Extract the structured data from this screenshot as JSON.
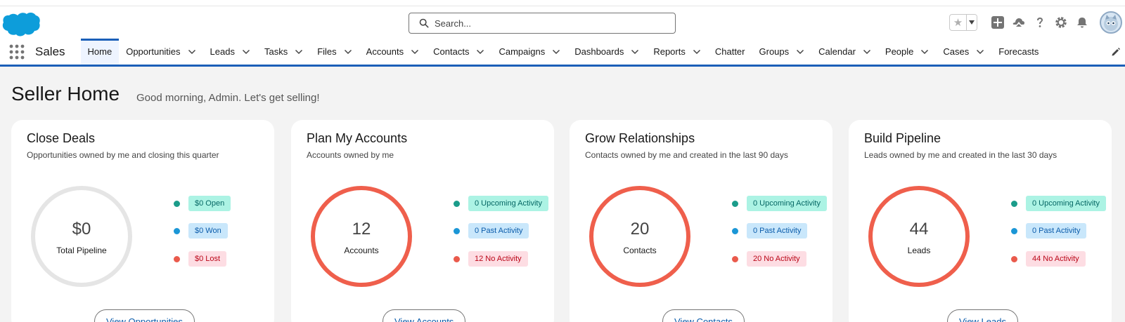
{
  "header": {
    "search_placeholder": "Search...",
    "icons": [
      "salesforce-cloud-logo",
      "star-icon",
      "chevron-down-icon",
      "plus-icon",
      "trailhead-icon",
      "help-icon",
      "gear-icon",
      "bell-icon",
      "avatar"
    ]
  },
  "nav": {
    "app_name": "Sales",
    "items": [
      {
        "label": "Home",
        "active": true,
        "dropdown": false
      },
      {
        "label": "Opportunities",
        "dropdown": true
      },
      {
        "label": "Leads",
        "dropdown": true
      },
      {
        "label": "Tasks",
        "dropdown": true
      },
      {
        "label": "Files",
        "dropdown": true
      },
      {
        "label": "Accounts",
        "dropdown": true
      },
      {
        "label": "Contacts",
        "dropdown": true
      },
      {
        "label": "Campaigns",
        "dropdown": true
      },
      {
        "label": "Dashboards",
        "dropdown": true
      },
      {
        "label": "Reports",
        "dropdown": true
      },
      {
        "label": "Chatter",
        "dropdown": false
      },
      {
        "label": "Groups",
        "dropdown": true
      },
      {
        "label": "Calendar",
        "dropdown": true
      },
      {
        "label": "People",
        "dropdown": true
      },
      {
        "label": "Cases",
        "dropdown": true
      },
      {
        "label": "Forecasts",
        "dropdown": false
      }
    ]
  },
  "page": {
    "title": "Seller Home",
    "greeting": "Good morning, Admin. Let's get selling!"
  },
  "cards": [
    {
      "title": "Close Deals",
      "subtitle": "Opportunities owned by me and closing this quarter",
      "ring_value": "$0",
      "ring_label": "Total Pipeline",
      "legend": [
        "$0 Open",
        "$0 Won",
        "$0 Lost"
      ],
      "button": "View Opportunities"
    },
    {
      "title": "Plan My Accounts",
      "subtitle": "Accounts owned by me",
      "ring_value": "12",
      "ring_label": "Accounts",
      "legend": [
        "0 Upcoming Activity",
        "0 Past Activity",
        "12 No Activity"
      ],
      "button": "View Accounts"
    },
    {
      "title": "Grow Relationships",
      "subtitle": "Contacts owned by me and created in the last 90 days",
      "ring_value": "20",
      "ring_label": "Contacts",
      "legend": [
        "0 Upcoming Activity",
        "0 Past Activity",
        "20 No Activity"
      ],
      "button": "View Contacts"
    },
    {
      "title": "Build Pipeline",
      "subtitle": "Leads owned by me and created in the last 30 days",
      "ring_value": "44",
      "ring_label": "Leads",
      "legend": [
        "0 Upcoming Activity",
        "0 Past Activity",
        "44 No Activity"
      ],
      "button": "View Leads"
    }
  ],
  "colors": {
    "brand_blue": "#1b5fb8",
    "ring_red": "#ef5f4c",
    "ring_gray": "#e5e5e5",
    "teal": "#1b9c8a",
    "blue": "#1b96d6",
    "red": "#ea5a4c"
  }
}
